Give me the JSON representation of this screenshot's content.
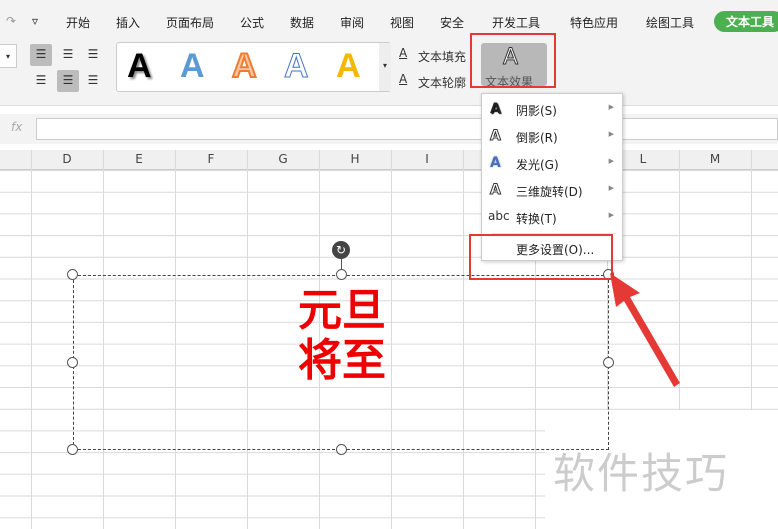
{
  "tabs": [
    "开始",
    "插入",
    "页面布局",
    "公式",
    "数据",
    "审阅",
    "视图",
    "安全",
    "开发工具",
    "特色应用",
    "绘图工具"
  ],
  "active_tab": "文本工具",
  "ribbon": {
    "fill": "文本填充",
    "outline": "文本轮廓",
    "effect": "文本效果",
    "style_letter": "A"
  },
  "formula": {
    "fx": "fx",
    "value": ""
  },
  "columns": [
    "D",
    "E",
    "F",
    "G",
    "H",
    "I",
    "",
    "",
    "L",
    "M"
  ],
  "menu": [
    {
      "icon": "A",
      "label": "阴影(S)"
    },
    {
      "icon": "A",
      "label": "倒影(R)"
    },
    {
      "icon": "A",
      "label": "发光(G)"
    },
    {
      "icon": "A",
      "label": "三维旋转(D)"
    },
    {
      "icon": "abc",
      "label": "转换(T)"
    }
  ],
  "menu_more": "更多设置(O)...",
  "textbox": {
    "line1": "元旦",
    "line2": "将至"
  },
  "watermark": "软件技巧",
  "colors": {
    "accent": "#4caf50",
    "highlight": "#e53935",
    "text": "#e00000"
  }
}
